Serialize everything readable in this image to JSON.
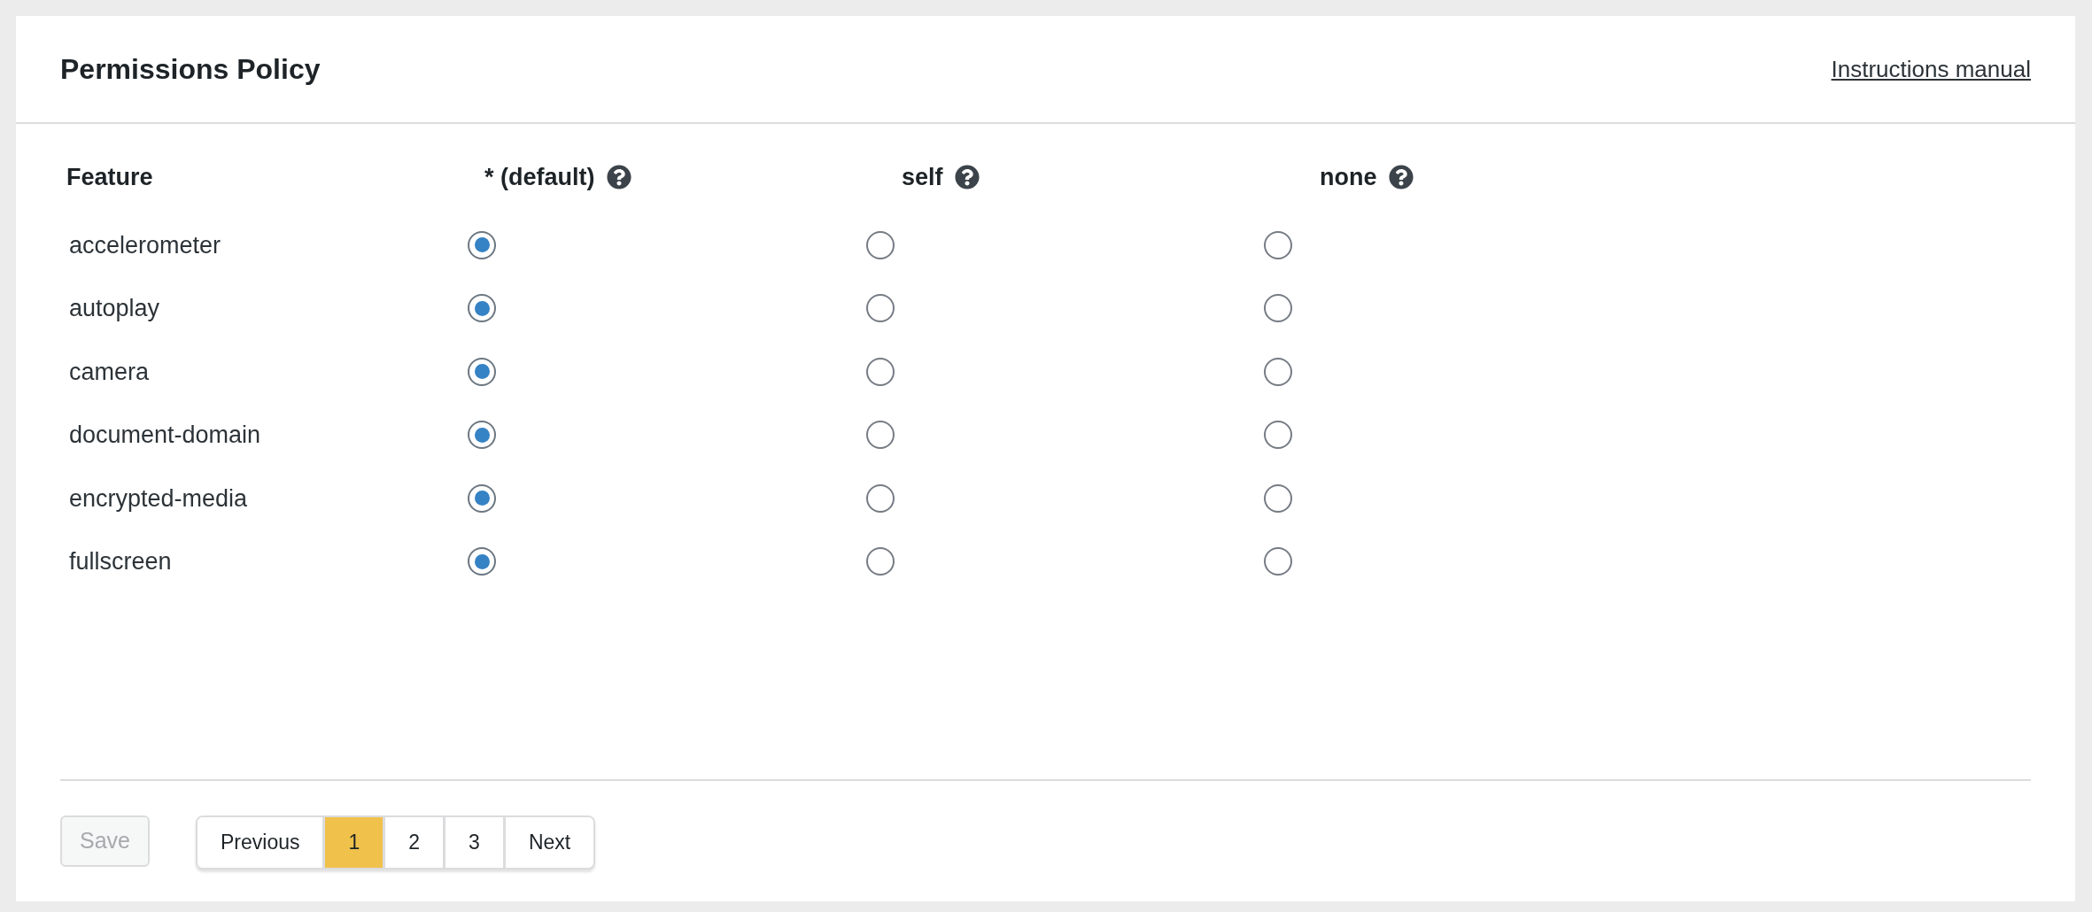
{
  "panel": {
    "title": "Permissions Policy",
    "help_link": "Instructions manual"
  },
  "table": {
    "columns": [
      {
        "label": "Feature",
        "help": false
      },
      {
        "label": "* (default)",
        "help": true
      },
      {
        "label": "self",
        "help": true
      },
      {
        "label": "none",
        "help": true
      }
    ],
    "rows": [
      {
        "feature": "accelerometer",
        "options": [
          {
            "selected": true
          },
          {
            "selected": false
          },
          {
            "selected": false
          }
        ]
      },
      {
        "feature": "autoplay",
        "options": [
          {
            "selected": true
          },
          {
            "selected": false
          },
          {
            "selected": false
          }
        ]
      },
      {
        "feature": "camera",
        "options": [
          {
            "selected": true
          },
          {
            "selected": false
          },
          {
            "selected": false
          }
        ]
      },
      {
        "feature": "document-domain",
        "options": [
          {
            "selected": true
          },
          {
            "selected": false
          },
          {
            "selected": false
          }
        ]
      },
      {
        "feature": "encrypted-media",
        "options": [
          {
            "selected": true
          },
          {
            "selected": false
          },
          {
            "selected": false
          }
        ]
      },
      {
        "feature": "fullscreen",
        "options": [
          {
            "selected": true
          },
          {
            "selected": false
          },
          {
            "selected": false
          }
        ]
      }
    ]
  },
  "footer": {
    "save_button": {
      "label": "Save",
      "disabled": true
    },
    "pagination": [
      {
        "label": "Previous",
        "selected": false
      },
      {
        "label": "1",
        "selected": true
      },
      {
        "label": "2",
        "selected": false
      },
      {
        "label": "3",
        "selected": false
      },
      {
        "label": "Next",
        "selected": false
      }
    ]
  }
}
